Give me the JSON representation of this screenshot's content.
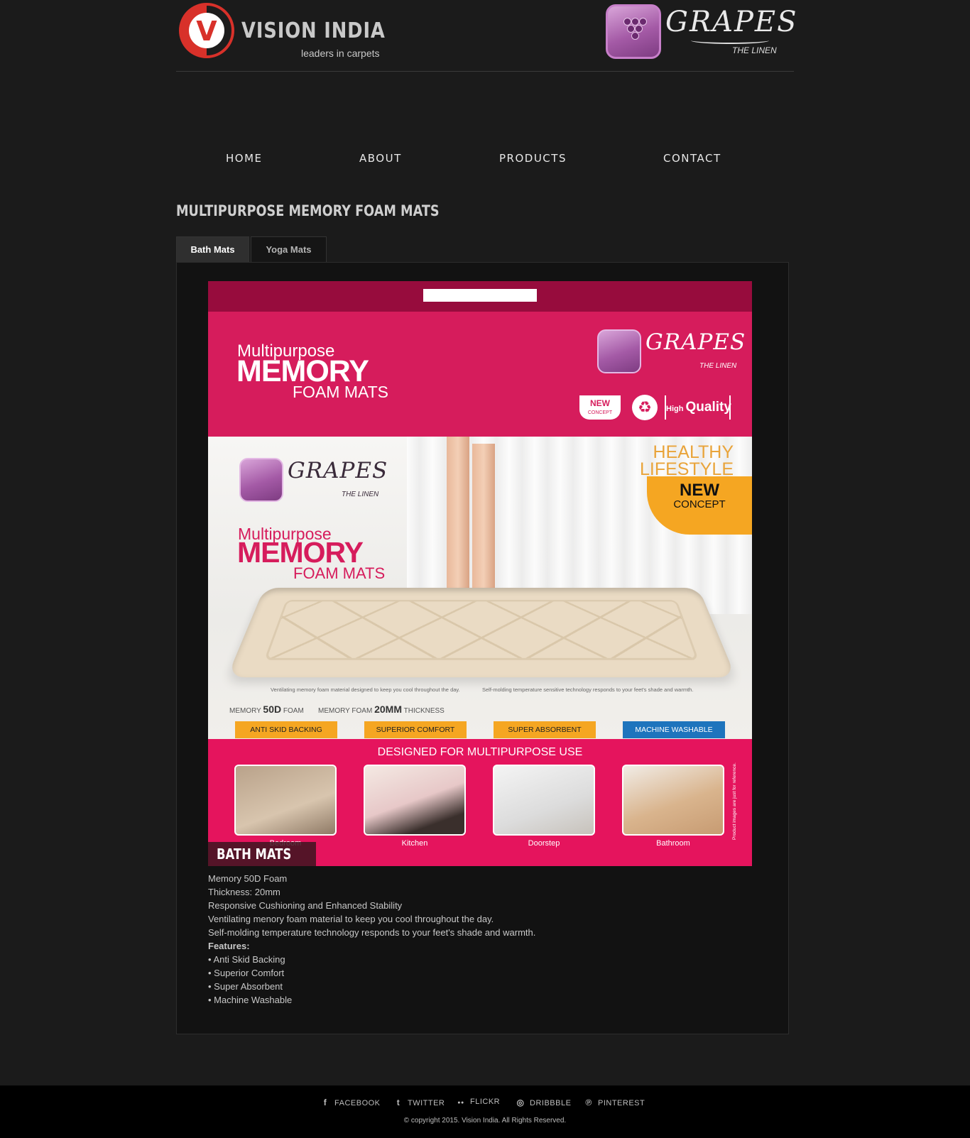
{
  "header": {
    "brand_name": "VISION INDIA",
    "brand_tagline": "leaders in carpets",
    "partner_name": "GRAPES",
    "partner_tagline": "THE LINEN"
  },
  "nav": {
    "items": [
      "HOME",
      "ABOUT",
      "PRODUCTS",
      "CONTACT"
    ]
  },
  "page": {
    "title": "MULTIPURPOSE MEMORY FOAM MATS",
    "tabs": [
      {
        "label": "Bath Mats",
        "active": true
      },
      {
        "label": "Yoga Mats",
        "active": false
      }
    ]
  },
  "product_image": {
    "headline_small": "Multipurpose",
    "headline_big": "MEMORY",
    "headline_sub": "FOAM MATS",
    "brand": "GRAPES",
    "brand_sub": "THE LINEN",
    "badge_new": "NEW",
    "badge_new_sub": "CONCEPT",
    "badge_hq_small": "High",
    "badge_hq_big": "Quality",
    "healthy_line1": "HEALTHY",
    "healthy_line2": "LIFESTYLE",
    "new_concept_1": "NEW",
    "new_concept_2": "CONCEPT",
    "note_left": "Ventilating memory foam material designed to keep you cool throughout the day.",
    "note_right": "Self-molding temperature sensitive technology responds to your feet's shade and warmth.",
    "spec_1_pre": "MEMORY",
    "spec_1_val": "50D",
    "spec_1_post": "FOAM",
    "spec_2_pre": "MEMORY FOAM",
    "spec_2_val": "20MM",
    "spec_2_post": "THICKNESS",
    "chips": [
      "ANTI SKID BACKING",
      "SUPERIOR COMFORT",
      "SUPER ABSORBENT",
      "MACHINE WASHABLE"
    ],
    "uses_heading": "DESIGNED FOR MULTIPURPOSE USE",
    "uses": [
      "Bedroom",
      "Kitchen",
      "Doorstep",
      "Bathroom"
    ],
    "side_note": "Product images are just for reference.",
    "caption": "BATH MATS"
  },
  "description": {
    "lines": [
      "Memory 50D Foam",
      "Thickness: 20mm",
      "Responsive Cushioning and Enhanced Stability",
      "Ventilating menory foam material to keep you cool throughout the day.",
      "Self-molding temperature technology responds to your feet's shade and warmth."
    ],
    "features_label": "Features:",
    "features": [
      "• Anti Skid Backing",
      "• Superior Comfort",
      "• Super Absorbent",
      "• Machine Washable"
    ]
  },
  "footer": {
    "social": [
      {
        "label": "FACEBOOK",
        "icon": "facebook-icon",
        "glyph": "f"
      },
      {
        "label": "TWITTER",
        "icon": "twitter-icon",
        "glyph": "t"
      },
      {
        "label": "FLICKR",
        "icon": "flickr-icon",
        "glyph": "●●"
      },
      {
        "label": "DRIBBBLE",
        "icon": "dribbble-icon",
        "glyph": "◎"
      },
      {
        "label": "PINTEREST",
        "icon": "pinterest-icon",
        "glyph": "℗"
      }
    ],
    "copyright": "© copyright 2015. Vision India. All Rights Reserved."
  },
  "colors": {
    "background": "#1b1b1b",
    "panel": "#121212",
    "brand_red": "#d8312a",
    "product_pink": "#d61c5c",
    "accent_orange": "#f5a622",
    "accent_blue": "#1e74bd"
  }
}
